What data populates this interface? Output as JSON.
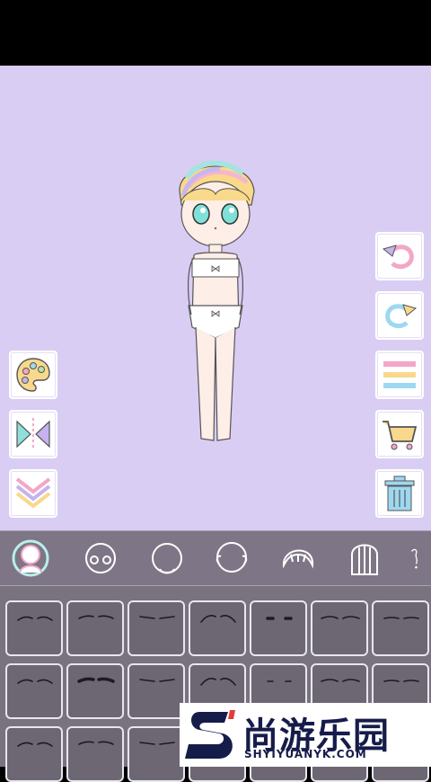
{
  "app": {
    "screen": "character-dress-up"
  },
  "left_tools": [
    {
      "icon": "palette-icon"
    },
    {
      "icon": "flip-icon"
    },
    {
      "icon": "collapse-chevron-icon"
    }
  ],
  "right_tools": [
    {
      "icon": "undo-icon"
    },
    {
      "icon": "redo-icon"
    },
    {
      "icon": "layers-icon"
    },
    {
      "icon": "cart-icon"
    },
    {
      "icon": "trash-icon"
    }
  ],
  "categories": [
    {
      "icon": "body-category-icon",
      "selected": true
    },
    {
      "icon": "face-category-icon",
      "selected": false
    },
    {
      "icon": "head-category-icon",
      "selected": false
    },
    {
      "icon": "head-outline-category-icon",
      "selected": false
    },
    {
      "icon": "front-hair-category-icon",
      "selected": false
    },
    {
      "icon": "back-hair-category-icon",
      "selected": false
    },
    {
      "icon": "more-category-icon",
      "selected": false
    }
  ],
  "eyebrow_options_count_visible": 21,
  "colors": {
    "stage_background": "#d9cdf4",
    "category_bar": "#7e7686",
    "option_grid": "#79727f"
  },
  "watermark": {
    "title": "尚游乐园",
    "subtitle": "SHYIYUANYK.COM"
  }
}
